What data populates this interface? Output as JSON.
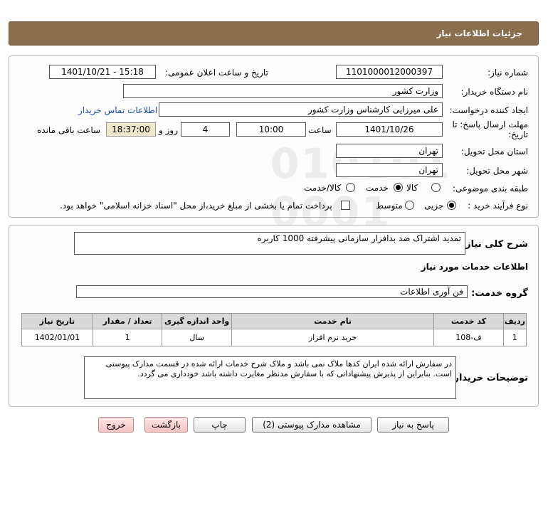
{
  "header": {
    "title": "جزئیات اطلاعات نیاز"
  },
  "form": {
    "need_number_label": "شماره نیاز:",
    "need_number": "1101000012000397",
    "announce_label": "تاریخ و ساعت اعلان عمومی:",
    "announce_value": "1401/10/21 - 15:18",
    "buyer_org_label": "نام دستگاه خریدار:",
    "buyer_org": "وزارت کشور",
    "creator_label": "ایجاد کننده درخواست:",
    "creator": "علی میرزایی کارشناس وزارت کشور",
    "contact_link": "اطلاعات تماس خریدار",
    "deadline_label_1": "مهلت ارسال پاسخ: تا",
    "deadline_label_2": "تاریخ:",
    "deadline_date": "1401/10/26",
    "time_label": "ساعت",
    "deadline_time": "10:00",
    "days_value": "4",
    "days_label": "روز و",
    "remaining_time": "18:37:00",
    "remaining_label": "ساعت باقی مانده",
    "province_label": "استان محل تحویل:",
    "province": "تهران",
    "city_label": "شهر محل تحویل:",
    "city": "تهران",
    "category_label": "طبقه بندی موضوعی:",
    "category_options": [
      "کالا",
      "خدمت",
      "کالا/خدمت"
    ],
    "process_label": "نوع فرآیند خرید :",
    "process_options": [
      "جزیی",
      "متوسط"
    ],
    "payment_note": "پرداخت تمام یا بخشی از مبلغ خرید،از محل \"اسناد خزانه اسلامی\" خواهد بود."
  },
  "details": {
    "general_desc_label": "شرح کلی نیاز:",
    "general_desc": "تمدید اشتراک ضد بدافزار سازمانی پیشرفته 1000 کاربره",
    "services_heading": "اطلاعات خدمات مورد نیاز",
    "service_group_label": "گروه خدمت:",
    "service_group": "فن آوری اطلاعات",
    "table": {
      "headers": [
        "ردیف",
        "کد خدمت",
        "نام خدمت",
        "واحد اندازه گیری",
        "تعداد / مقدار",
        "تاریخ نیاز"
      ],
      "rows": [
        [
          "1",
          "ف-108",
          "خرید نرم افزار",
          "سال",
          "1",
          "1402/01/01"
        ]
      ]
    },
    "buyer_notes_label": "توضیحات خریدار:",
    "buyer_notes": "در سفارش ارائه شده ایران کدها ملاک نمی باشد و ملاک شرح خدمات ارائه شده در قسمت مدارک پیوستی است. بنابراین از پذیرش پیشنهاداتی که با سفارش مدنظر مغایرت داشته باشد خودداری می گردد."
  },
  "buttons": {
    "reply": "پاسخ به نیاز",
    "attachments": "مشاهده مدارک پیوستی (2)",
    "print": "چاپ",
    "back": "بازگشت",
    "exit": "خروج"
  }
}
